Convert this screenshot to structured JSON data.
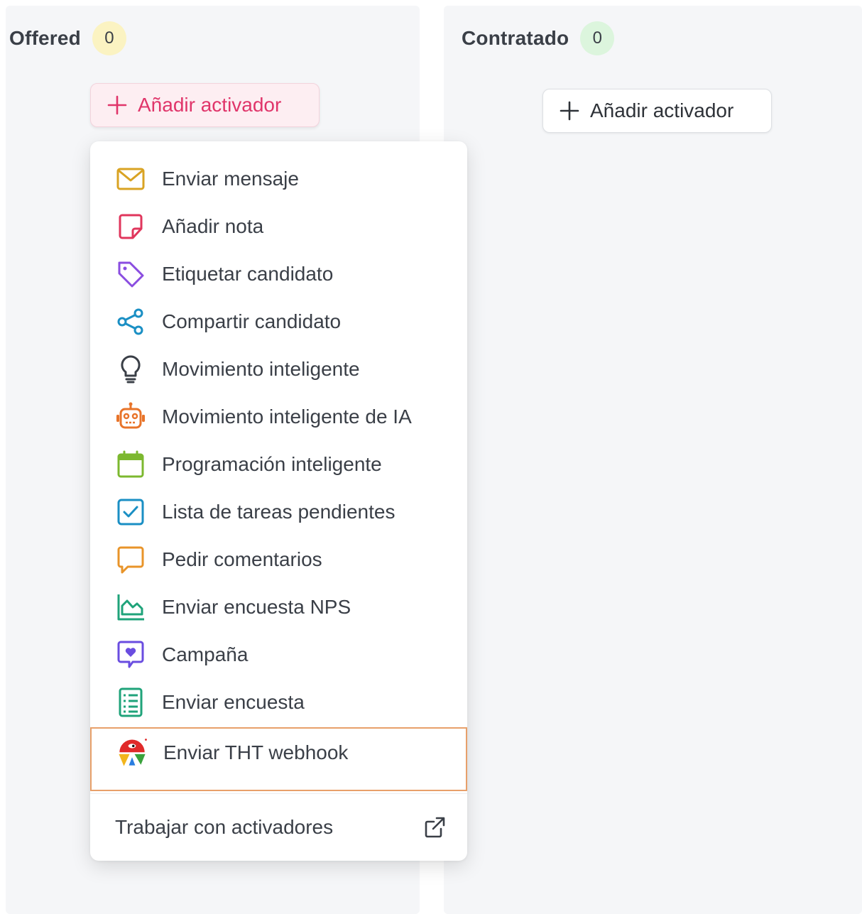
{
  "columns": [
    {
      "title": "Offered",
      "count": "0",
      "badge_color": "#fbf3c2",
      "add_label": "Añadir activador",
      "state": "open"
    },
    {
      "title": "Contratado",
      "count": "0",
      "badge_color": "#dcf5dd",
      "add_label": "Añadir activador",
      "state": "closed"
    }
  ],
  "dropdown": {
    "items": [
      {
        "label": "Enviar mensaje",
        "icon": "envelope-icon",
        "color": "#d9a323"
      },
      {
        "label": "Añadir nota",
        "icon": "note-icon",
        "color": "#e0365c"
      },
      {
        "label": "Etiquetar candidato",
        "icon": "tag-icon",
        "color": "#8a4de0"
      },
      {
        "label": "Compartir candidato",
        "icon": "share-icon",
        "color": "#1a8fc4"
      },
      {
        "label": "Movimiento inteligente",
        "icon": "lightbulb-icon",
        "color": "#3a3f47"
      },
      {
        "label": "Movimiento inteligente de IA",
        "icon": "robot-icon",
        "color": "#e8742a"
      },
      {
        "label": "Programación inteligente",
        "icon": "calendar-icon",
        "color": "#7cb82f"
      },
      {
        "label": "Lista de tareas pendientes",
        "icon": "checkbox-icon",
        "color": "#1a8fc4"
      },
      {
        "label": "Pedir comentarios",
        "icon": "comment-icon",
        "color": "#e8942a"
      },
      {
        "label": "Enviar encuesta NPS",
        "icon": "chart-icon",
        "color": "#1fa37a"
      },
      {
        "label": "Campaña",
        "icon": "heart-message-icon",
        "color": "#6a4de0"
      },
      {
        "label": "Enviar encuesta",
        "icon": "survey-list-icon",
        "color": "#1fa37a"
      },
      {
        "label": "Enviar THT webhook",
        "icon": "tht-logo-icon",
        "color": "#e8a06a"
      }
    ],
    "footer_label": "Trabajar con activadores",
    "footer_icon": "external-link-icon"
  },
  "colors": {
    "accent_pink": "#e0356a",
    "highlight_border": "#e8a06a",
    "column_bg": "#f5f6f8"
  }
}
